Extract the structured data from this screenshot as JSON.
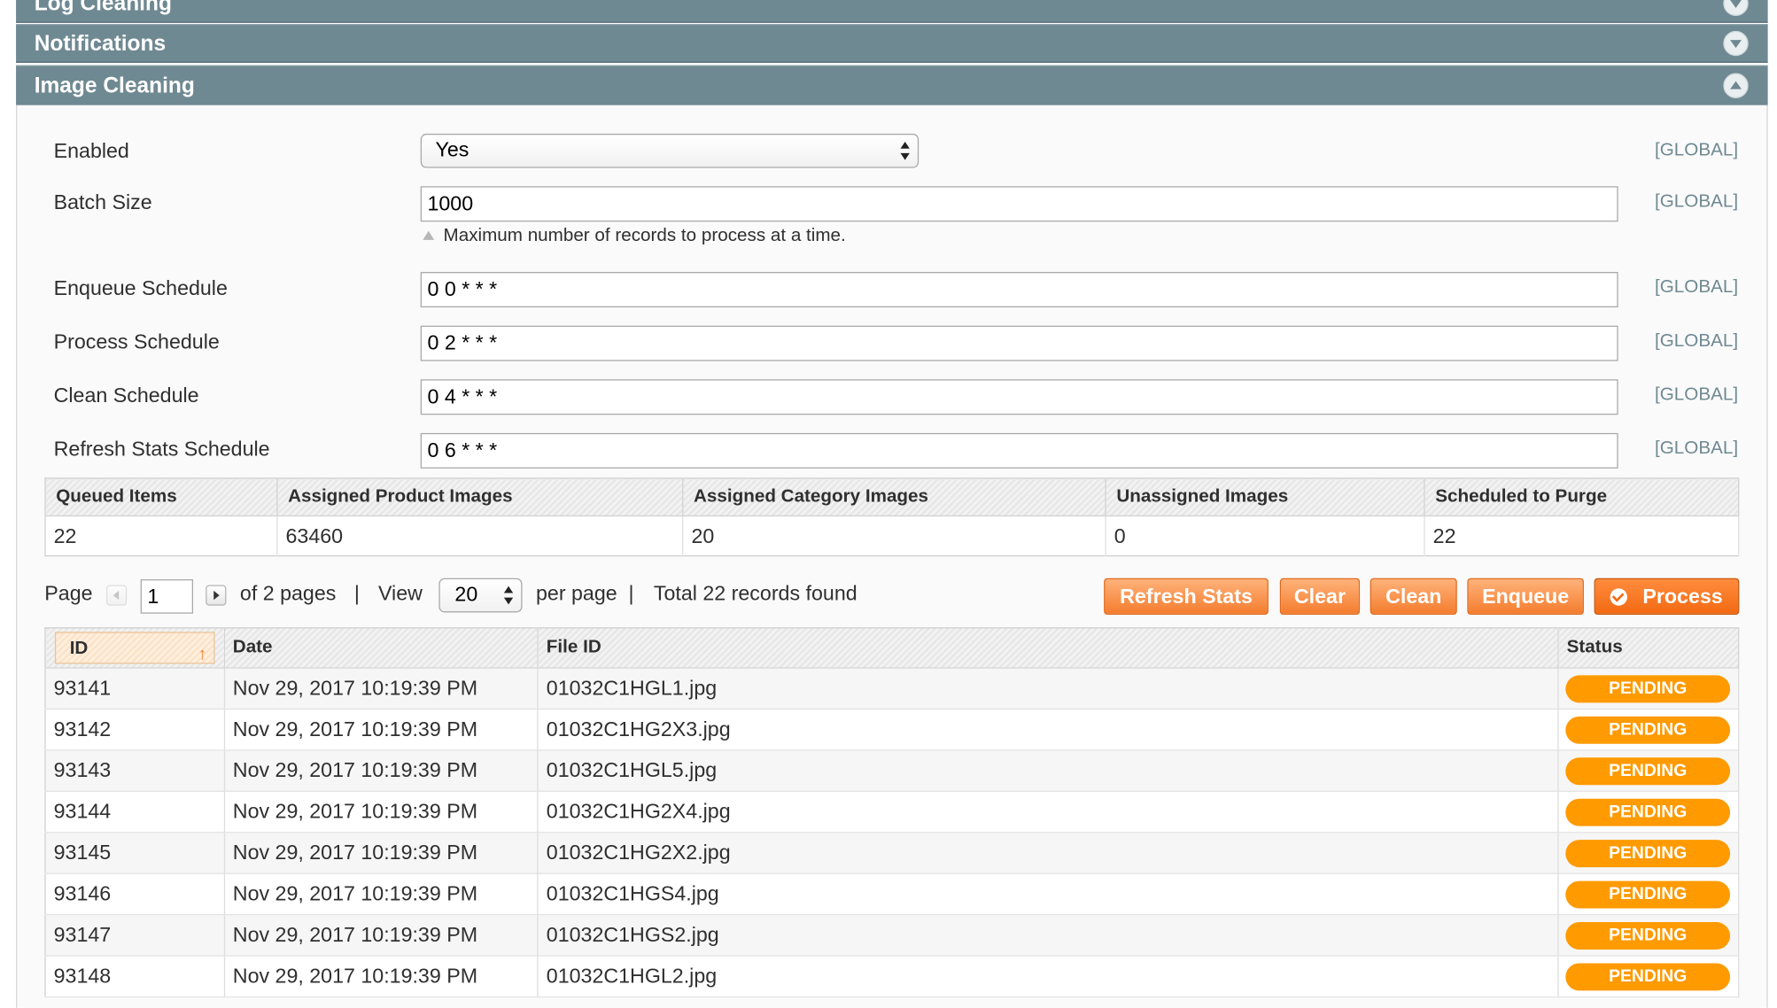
{
  "sections": {
    "log_cleaning": "Log Cleaning",
    "notifications": "Notifications",
    "image_cleaning": "Image Cleaning"
  },
  "form": {
    "scope_label": "[GLOBAL]",
    "enabled": {
      "label": "Enabled",
      "value": "Yes"
    },
    "batch_size": {
      "label": "Batch Size",
      "value": "1000",
      "hint": "Maximum number of records to process at a time."
    },
    "enqueue_schedule": {
      "label": "Enqueue Schedule",
      "value": "0 0 * * *"
    },
    "process_schedule": {
      "label": "Process Schedule",
      "value": "0 2 * * *"
    },
    "clean_schedule": {
      "label": "Clean Schedule",
      "value": "0 4 * * *"
    },
    "refresh_stats_schedule": {
      "label": "Refresh Stats Schedule",
      "value": "0 6 * * *"
    }
  },
  "stats": {
    "headers": [
      "Queued Items",
      "Assigned Product Images",
      "Assigned Category Images",
      "Unassigned Images",
      "Scheduled to Purge"
    ],
    "values": [
      "22",
      "63460",
      "20",
      "0",
      "22"
    ]
  },
  "pager": {
    "page_label": "Page",
    "page_value": "1",
    "of_pages": "of 2 pages",
    "sep": "|",
    "view_label": "View",
    "per_page_value": "20",
    "per_page_label": "per page",
    "total": "Total 22 records found"
  },
  "actions": {
    "refresh_stats": "Refresh Stats",
    "clear": "Clear",
    "clean": "Clean",
    "enqueue": "Enqueue",
    "process": "Process"
  },
  "grid": {
    "columns": [
      "ID",
      "Date",
      "File ID",
      "Status"
    ],
    "rows": [
      {
        "id": "93141",
        "date": "Nov 29, 2017 10:19:39 PM",
        "file": "01032C1HGL1.jpg",
        "status": "PENDING"
      },
      {
        "id": "93142",
        "date": "Nov 29, 2017 10:19:39 PM",
        "file": "01032C1HG2X3.jpg",
        "status": "PENDING"
      },
      {
        "id": "93143",
        "date": "Nov 29, 2017 10:19:39 PM",
        "file": "01032C1HGL5.jpg",
        "status": "PENDING"
      },
      {
        "id": "93144",
        "date": "Nov 29, 2017 10:19:39 PM",
        "file": "01032C1HG2X4.jpg",
        "status": "PENDING"
      },
      {
        "id": "93145",
        "date": "Nov 29, 2017 10:19:39 PM",
        "file": "01032C1HG2X2.jpg",
        "status": "PENDING"
      },
      {
        "id": "93146",
        "date": "Nov 29, 2017 10:19:39 PM",
        "file": "01032C1HGS4.jpg",
        "status": "PENDING"
      },
      {
        "id": "93147",
        "date": "Nov 29, 2017 10:19:39 PM",
        "file": "01032C1HGS2.jpg",
        "status": "PENDING"
      },
      {
        "id": "93148",
        "date": "Nov 29, 2017 10:19:39 PM",
        "file": "01032C1HGL2.jpg",
        "status": "PENDING"
      }
    ]
  },
  "colors": {
    "section_header": "#6f8992",
    "scope_text": "#6f8992",
    "button": "#f47d2e",
    "status_pending": "#ff9a00"
  },
  "icons": {
    "collapsed": "chevron-down-circle-icon",
    "expanded": "chevron-up-circle-icon",
    "select": "up-down-arrows-icon",
    "sort": "sort-ascending-icon"
  }
}
